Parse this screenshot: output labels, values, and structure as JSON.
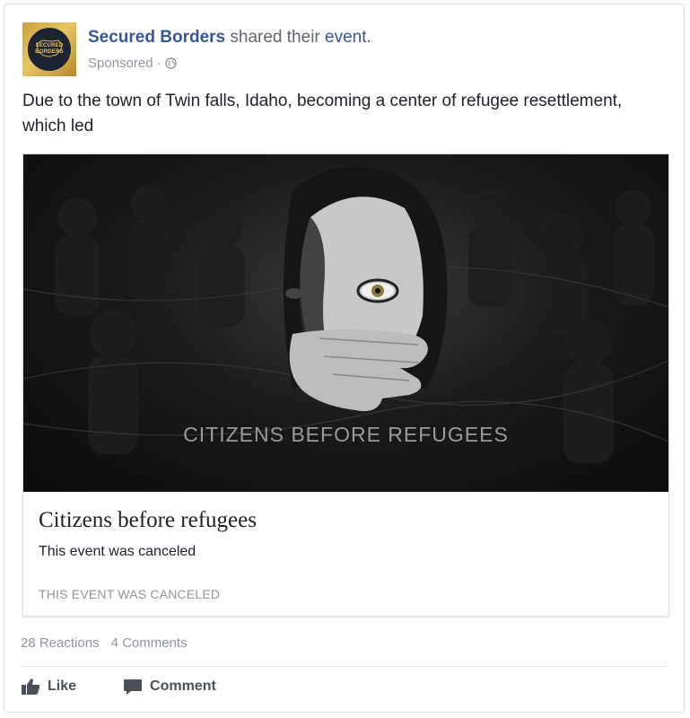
{
  "post": {
    "page_name": "Secured Borders",
    "shared_text": "shared their",
    "event_link": "event.",
    "sponsored": "Sponsored",
    "separator": "·",
    "avatar_text": "SECURED BORDERS",
    "body": "Due to the town of Twin falls, Idaho, becoming a center of refugee resettlement, which led"
  },
  "attachment": {
    "image_caption": "CITIZENS BEFORE REFUGEES",
    "title": "Citizens before refugees",
    "subtitle": "This event was canceled",
    "status": "THIS EVENT WAS CANCELED"
  },
  "engagement": {
    "reactions": "28 Reactions",
    "comments": "4 Comments"
  },
  "actions": {
    "like": "Like",
    "comment": "Comment"
  },
  "icons": {
    "globe": "globe-icon",
    "like": "thumbs-up-icon",
    "comment": "comment-bubble-icon"
  },
  "colors": {
    "link_blue": "#365899",
    "meta_gray": "#90949c",
    "text_dark": "#1d2129",
    "gold": "#d9b64c"
  }
}
